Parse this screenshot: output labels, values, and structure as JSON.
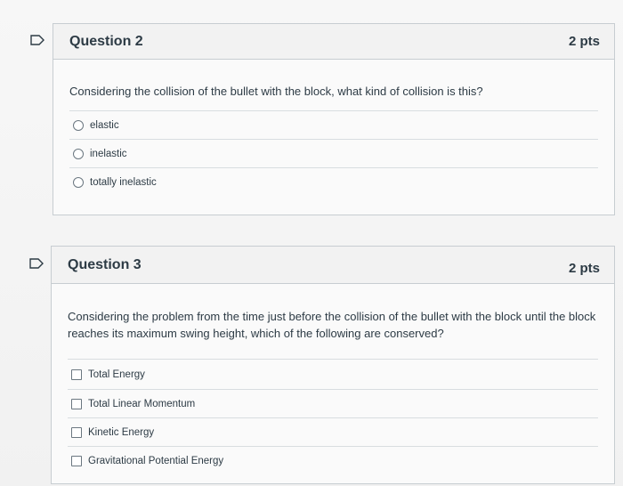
{
  "questions": [
    {
      "title": "Question 2",
      "points": "2 pts",
      "text": "Considering the collision of the bullet with the block, what kind of collision is this?",
      "input_type": "radio",
      "answers": [
        "elastic",
        "inelastic",
        "totally inelastic"
      ]
    },
    {
      "title": "Question 3",
      "points": "2 pts",
      "text": "Considering the problem from the time just before the collision of the bullet with the block until the block reaches its maximum swing height, which of the following are conserved?",
      "input_type": "checkbox",
      "answers": [
        "Total Energy",
        "Total Linear Momentum",
        "Kinetic Energy",
        "Gravitational Potential Energy"
      ]
    }
  ],
  "colors": {
    "flag": "#2d3b45",
    "border": "#c7cdd1",
    "text": "#2d3b45"
  },
  "icons": [
    "flag-icon"
  ]
}
